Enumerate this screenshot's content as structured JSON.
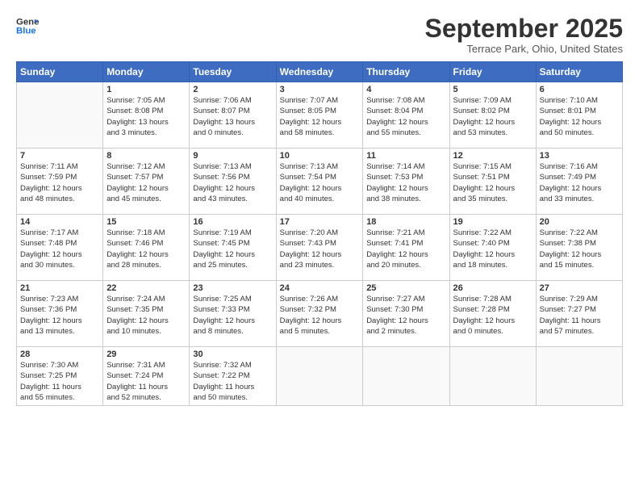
{
  "logo": {
    "line1": "General",
    "line2": "Blue"
  },
  "title": "September 2025",
  "location": "Terrace Park, Ohio, United States",
  "weekdays": [
    "Sunday",
    "Monday",
    "Tuesday",
    "Wednesday",
    "Thursday",
    "Friday",
    "Saturday"
  ],
  "weeks": [
    [
      {
        "day": "",
        "info": ""
      },
      {
        "day": "1",
        "info": "Sunrise: 7:05 AM\nSunset: 8:08 PM\nDaylight: 13 hours\nand 3 minutes."
      },
      {
        "day": "2",
        "info": "Sunrise: 7:06 AM\nSunset: 8:07 PM\nDaylight: 13 hours\nand 0 minutes."
      },
      {
        "day": "3",
        "info": "Sunrise: 7:07 AM\nSunset: 8:05 PM\nDaylight: 12 hours\nand 58 minutes."
      },
      {
        "day": "4",
        "info": "Sunrise: 7:08 AM\nSunset: 8:04 PM\nDaylight: 12 hours\nand 55 minutes."
      },
      {
        "day": "5",
        "info": "Sunrise: 7:09 AM\nSunset: 8:02 PM\nDaylight: 12 hours\nand 53 minutes."
      },
      {
        "day": "6",
        "info": "Sunrise: 7:10 AM\nSunset: 8:01 PM\nDaylight: 12 hours\nand 50 minutes."
      }
    ],
    [
      {
        "day": "7",
        "info": "Sunrise: 7:11 AM\nSunset: 7:59 PM\nDaylight: 12 hours\nand 48 minutes."
      },
      {
        "day": "8",
        "info": "Sunrise: 7:12 AM\nSunset: 7:57 PM\nDaylight: 12 hours\nand 45 minutes."
      },
      {
        "day": "9",
        "info": "Sunrise: 7:13 AM\nSunset: 7:56 PM\nDaylight: 12 hours\nand 43 minutes."
      },
      {
        "day": "10",
        "info": "Sunrise: 7:13 AM\nSunset: 7:54 PM\nDaylight: 12 hours\nand 40 minutes."
      },
      {
        "day": "11",
        "info": "Sunrise: 7:14 AM\nSunset: 7:53 PM\nDaylight: 12 hours\nand 38 minutes."
      },
      {
        "day": "12",
        "info": "Sunrise: 7:15 AM\nSunset: 7:51 PM\nDaylight: 12 hours\nand 35 minutes."
      },
      {
        "day": "13",
        "info": "Sunrise: 7:16 AM\nSunset: 7:49 PM\nDaylight: 12 hours\nand 33 minutes."
      }
    ],
    [
      {
        "day": "14",
        "info": "Sunrise: 7:17 AM\nSunset: 7:48 PM\nDaylight: 12 hours\nand 30 minutes."
      },
      {
        "day": "15",
        "info": "Sunrise: 7:18 AM\nSunset: 7:46 PM\nDaylight: 12 hours\nand 28 minutes."
      },
      {
        "day": "16",
        "info": "Sunrise: 7:19 AM\nSunset: 7:45 PM\nDaylight: 12 hours\nand 25 minutes."
      },
      {
        "day": "17",
        "info": "Sunrise: 7:20 AM\nSunset: 7:43 PM\nDaylight: 12 hours\nand 23 minutes."
      },
      {
        "day": "18",
        "info": "Sunrise: 7:21 AM\nSunset: 7:41 PM\nDaylight: 12 hours\nand 20 minutes."
      },
      {
        "day": "19",
        "info": "Sunrise: 7:22 AM\nSunset: 7:40 PM\nDaylight: 12 hours\nand 18 minutes."
      },
      {
        "day": "20",
        "info": "Sunrise: 7:22 AM\nSunset: 7:38 PM\nDaylight: 12 hours\nand 15 minutes."
      }
    ],
    [
      {
        "day": "21",
        "info": "Sunrise: 7:23 AM\nSunset: 7:36 PM\nDaylight: 12 hours\nand 13 minutes."
      },
      {
        "day": "22",
        "info": "Sunrise: 7:24 AM\nSunset: 7:35 PM\nDaylight: 12 hours\nand 10 minutes."
      },
      {
        "day": "23",
        "info": "Sunrise: 7:25 AM\nSunset: 7:33 PM\nDaylight: 12 hours\nand 8 minutes."
      },
      {
        "day": "24",
        "info": "Sunrise: 7:26 AM\nSunset: 7:32 PM\nDaylight: 12 hours\nand 5 minutes."
      },
      {
        "day": "25",
        "info": "Sunrise: 7:27 AM\nSunset: 7:30 PM\nDaylight: 12 hours\nand 2 minutes."
      },
      {
        "day": "26",
        "info": "Sunrise: 7:28 AM\nSunset: 7:28 PM\nDaylight: 12 hours\nand 0 minutes."
      },
      {
        "day": "27",
        "info": "Sunrise: 7:29 AM\nSunset: 7:27 PM\nDaylight: 11 hours\nand 57 minutes."
      }
    ],
    [
      {
        "day": "28",
        "info": "Sunrise: 7:30 AM\nSunset: 7:25 PM\nDaylight: 11 hours\nand 55 minutes."
      },
      {
        "day": "29",
        "info": "Sunrise: 7:31 AM\nSunset: 7:24 PM\nDaylight: 11 hours\nand 52 minutes."
      },
      {
        "day": "30",
        "info": "Sunrise: 7:32 AM\nSunset: 7:22 PM\nDaylight: 11 hours\nand 50 minutes."
      },
      {
        "day": "",
        "info": ""
      },
      {
        "day": "",
        "info": ""
      },
      {
        "day": "",
        "info": ""
      },
      {
        "day": "",
        "info": ""
      }
    ]
  ]
}
